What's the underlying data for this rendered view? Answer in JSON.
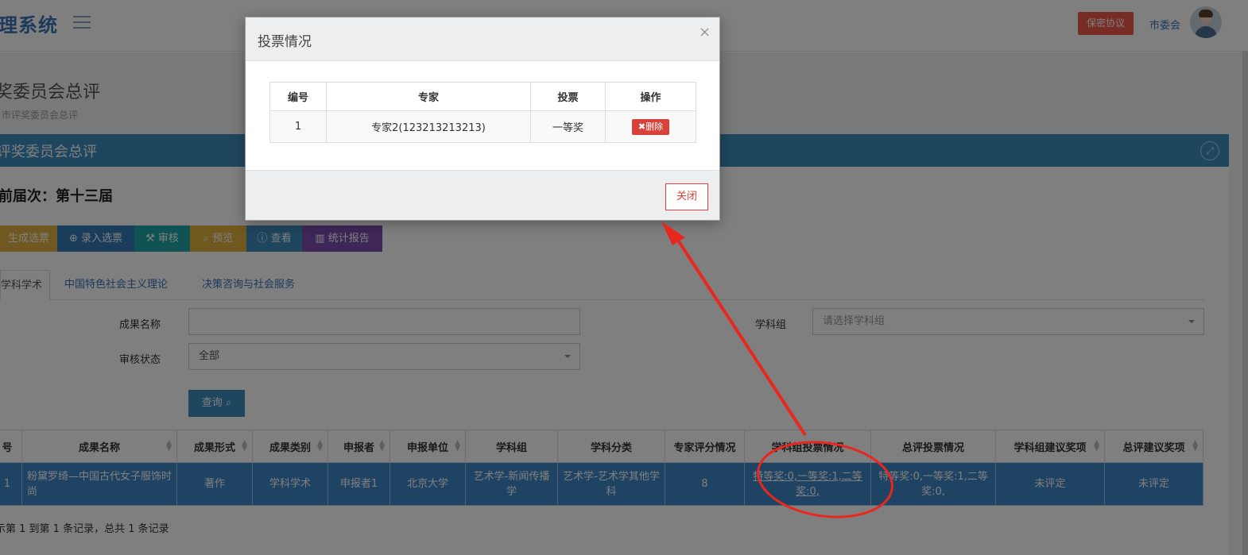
{
  "navbar": {
    "brand": "理系统",
    "secret_btn": "保密协议",
    "user_name": "市委会"
  },
  "page": {
    "title": "奖委员会总评",
    "breadcrumb": "市评奖委员会总评",
    "panel_title": "评奖委员会总评",
    "session_label": "前届次：第十三届"
  },
  "toolbar": {
    "generate": "生成选票",
    "input": "录入选票",
    "audit": "审核",
    "preview": "预览",
    "view": "查看",
    "stat": "统计报告"
  },
  "tabs": [
    "学科学术",
    "中国特色社会主义理论",
    "决策咨询与社会服务"
  ],
  "form": {
    "name_label": "成果名称",
    "name_value": "",
    "group_label": "学科组",
    "group_placeholder": "请选择学科组",
    "status_label": "审核状态",
    "status_value": "全部",
    "query_btn": "查询"
  },
  "table": {
    "headers": [
      "号",
      "成果名称",
      "成果形式",
      "成果类别",
      "申报者",
      "申报单位",
      "学科组",
      "学科分类",
      "专家评分情况",
      "学科组投票情况",
      "总评投票情况",
      "学科组建议奖项",
      "总评建议奖项"
    ],
    "row": {
      "no": "1",
      "name": "粉黛罗绮—中国古代女子服饰时尚",
      "form": "著作",
      "category": "学科学术",
      "applicant": "申报者1",
      "unit": "北京大学",
      "group": "艺术学-新闻传播学",
      "subject": "艺术学-艺术学其他学科",
      "score": "8",
      "group_vote": "特等奖:0,一等奖:1,二等奖:0,",
      "total_vote": "特等奖:0,一等奖:1,二等奖:0,",
      "group_award": "未评定",
      "total_award": "未评定"
    },
    "records": "示第 1 到第 1 条记录，总共 1 条记录"
  },
  "modal": {
    "title": "投票情况",
    "close_x": "×",
    "headers": [
      "编号",
      "专家",
      "投票",
      "操作"
    ],
    "row": {
      "no": "1",
      "expert": "专家2(123213213213)",
      "vote": "一等奖",
      "action": "删除"
    },
    "close_btn": "关闭"
  },
  "colors": {
    "primary": "#3c8dbc",
    "danger": "#d9423a",
    "annotation": "#e8271e"
  }
}
